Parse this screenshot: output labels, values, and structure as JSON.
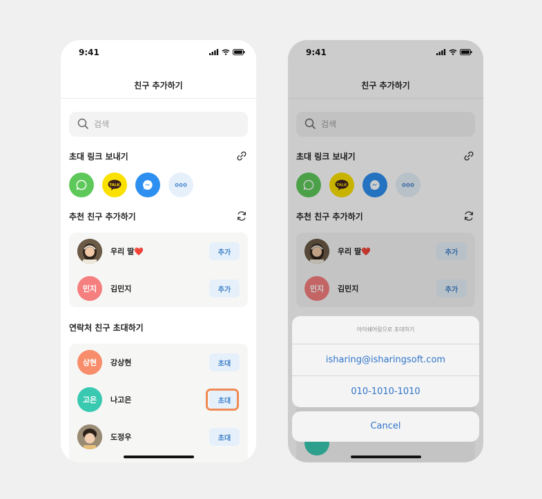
{
  "status": {
    "time": "9:41"
  },
  "nav": {
    "title": "친구 추가하기"
  },
  "search": {
    "placeholder": "검색"
  },
  "sections": {
    "invite_link": "초대 링크 보내기",
    "recommended": "추천 친구 추가하기",
    "contacts": "연락처 친구 초대하기"
  },
  "share_targets": [
    {
      "name": "messages",
      "color": "#5ec95a"
    },
    {
      "name": "kakaotalk",
      "color": "#fae100",
      "label": "TALK"
    },
    {
      "name": "messenger",
      "color": "#2d8ff0"
    },
    {
      "name": "more",
      "color": "#e6f0fb"
    }
  ],
  "recommended": [
    {
      "name": "우리 딸❤️",
      "avatar": "photo-girl",
      "button": "추가"
    },
    {
      "name": "김민지",
      "initials": "민지",
      "avatar_color": "#f57f7f",
      "button": "추가"
    }
  ],
  "contacts": [
    {
      "name": "강상현",
      "initials": "상현",
      "avatar_color": "#f78d6a",
      "button": "초대"
    },
    {
      "name": "나고은",
      "initials": "고은",
      "avatar_color": "#39c9b1",
      "button": "초대"
    },
    {
      "name": "도정우",
      "avatar": "photo-boy",
      "button": "초대"
    }
  ],
  "sheet": {
    "title": "아이쉐어링으로 초대하기",
    "options": [
      "isharing@isharingsoft.com",
      "010-1010-1010"
    ],
    "cancel": "Cancel"
  },
  "colors": {
    "accent": "#2f74c9",
    "highlight": "#f08a54",
    "button_bg": "#e6f0fb"
  }
}
